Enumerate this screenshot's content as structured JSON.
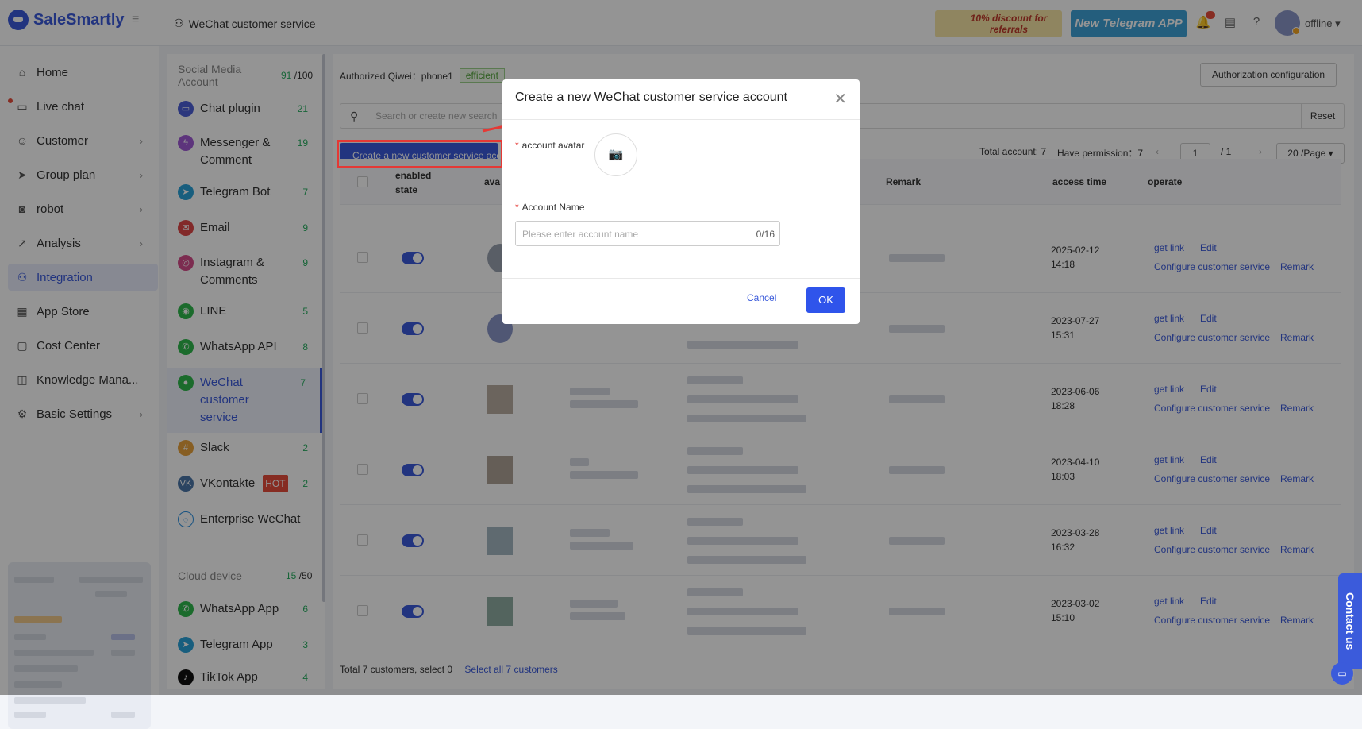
{
  "app": {
    "logo": "SaleSmartly",
    "breadcrumb": "WeChat customer service"
  },
  "topbar": {
    "promo1": "10% discount for referrals",
    "promo2": "New Telegram APP",
    "status": "offline"
  },
  "sidebar": {
    "items": [
      {
        "label": "Home",
        "icon": "home-icon"
      },
      {
        "label": "Live chat",
        "icon": "chat-icon"
      },
      {
        "label": "Customer",
        "icon": "users-icon"
      },
      {
        "label": "Group plan",
        "icon": "send-icon"
      },
      {
        "label": "robot",
        "icon": "robot-icon"
      },
      {
        "label": "Analysis",
        "icon": "chart-icon"
      },
      {
        "label": "Integration",
        "icon": "integration-icon"
      },
      {
        "label": "App Store",
        "icon": "apps-icon"
      },
      {
        "label": "Cost Center",
        "icon": "wallet-icon"
      },
      {
        "label": "Knowledge Mana...",
        "icon": "book-icon"
      },
      {
        "label": "Basic Settings",
        "icon": "gear-icon"
      }
    ]
  },
  "subpanel": {
    "social_header": "Social Media Account",
    "social_used": "91",
    "social_total": "/100",
    "items": [
      {
        "label": "Chat plugin",
        "count": "21"
      },
      {
        "label": "Messenger & Comment",
        "count": "19"
      },
      {
        "label": "Telegram Bot",
        "count": "7"
      },
      {
        "label": "Email",
        "count": "9"
      },
      {
        "label": "Instagram & Comments",
        "count": "9"
      },
      {
        "label": "LINE",
        "count": "5"
      },
      {
        "label": "WhatsApp API",
        "count": "8"
      },
      {
        "label": "WeChat customer service",
        "count": "7"
      },
      {
        "label": "Slack",
        "count": "2"
      },
      {
        "label": "VKontakte",
        "count": "2",
        "badge": "HOT"
      },
      {
        "label": "Enterprise WeChat",
        "count": ""
      }
    ],
    "cloud_header": "Cloud device",
    "cloud_used": "15",
    "cloud_total": "/50",
    "cloud_items": [
      {
        "label": "WhatsApp App",
        "count": "6"
      },
      {
        "label": "Telegram App",
        "count": "3"
      },
      {
        "label": "TikTok App",
        "count": "4"
      }
    ]
  },
  "main": {
    "authorized": "Authorized Qiwei：phone1",
    "efficient": "efficient",
    "auth_config": "Authorization configuration",
    "search_placeholder": "Search or create new search",
    "reset": "Reset",
    "create_button": "Create a new customer service account",
    "total_account": "Total account: 7",
    "have_permission": "Have permission：7",
    "page_current": "1",
    "page_total": "/ 1",
    "page_size": "20 /Page",
    "columns": {
      "enabled": "enabled state",
      "avatar": "ava",
      "remark": "Remark",
      "access_time": "access time",
      "operate": "operate"
    },
    "rows": [
      {
        "time": "2025-02-12 14:18"
      },
      {
        "time": "2023-07-27 15:31"
      },
      {
        "time": "2023-06-06 18:28"
      },
      {
        "time": "2023-04-10 18:03"
      },
      {
        "time": "2023-03-28 16:32"
      },
      {
        "time": "2023-03-02 15:10"
      }
    ],
    "op_get_link": "get link",
    "op_edit": "Edit",
    "op_configure": "Configure customer service",
    "op_remark": "Remark",
    "footer_total": "Total 7 customers, select 0",
    "footer_select_all": "Select all 7 customers"
  },
  "modal": {
    "title": "Create a new WeChat customer service account",
    "avatar_label": "account avatar",
    "name_label": "Account Name",
    "name_placeholder": "Please enter account name",
    "name_count": "0/16",
    "cancel": "Cancel",
    "ok": "OK"
  },
  "contact": "Contact us",
  "colors": {
    "accent": "#3b5bdb",
    "ok_button": "#2f54eb",
    "count_green": "#27ae60",
    "highlight_red": "#e53935"
  }
}
